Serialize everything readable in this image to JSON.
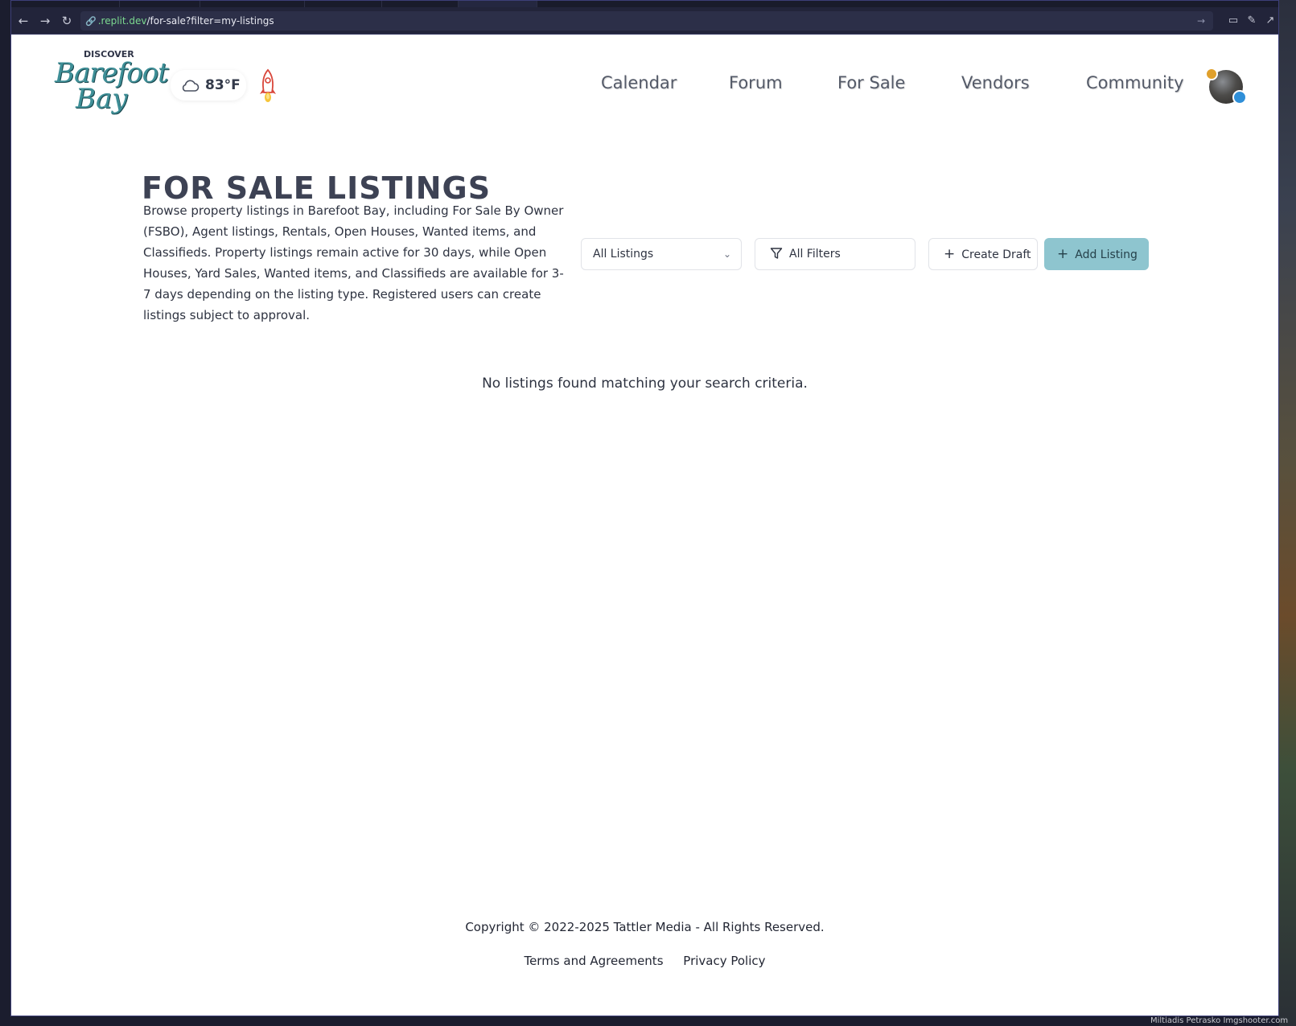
{
  "browser": {
    "url_domain": ".replit.dev",
    "url_path": "/for-sale?filter=my-listings",
    "back_icon": "arrow-left-icon",
    "forward_icon": "arrow-right-icon",
    "reload_icon": "reload-icon"
  },
  "header": {
    "logo": {
      "top_text": "DISCOVER",
      "line1": "Barefoot",
      "line2": "Bay"
    },
    "weather": {
      "temperature": "83°F",
      "icon": "cloud-icon"
    },
    "nav": [
      {
        "label": "Calendar"
      },
      {
        "label": "Forum"
      },
      {
        "label": "For Sale"
      },
      {
        "label": "Vendors"
      },
      {
        "label": "Community"
      }
    ]
  },
  "main": {
    "title": "FOR SALE LISTINGS",
    "description": "Browse property listings in Barefoot Bay, including For Sale By Owner (FSBO), Agent listings, Rentals, Open Houses, Wanted items, and Classifieds. Property listings remain active for 30 days, while Open Houses, Yard Sales, Wanted items, and Classifieds are available for 3-7 days depending on the listing type. Registered users can create listings subject to approval.",
    "listing_filter_value": "All Listings",
    "filters_label": "All Filters",
    "create_draft_label": "Create Draft",
    "add_listing_label": "Add Listing",
    "empty_message": "No listings found matching your search criteria."
  },
  "footer": {
    "copyright": "Copyright © 2022-2025 Tattler Media - All Rights Reserved.",
    "links": [
      "Terms and Agreements",
      "Privacy Policy"
    ]
  },
  "colors": {
    "accent_button": "#8ec5cf",
    "logo_teal": "#3e8f97",
    "text": "#2e3341"
  },
  "desktop": {
    "caption": "Miltiadis Petrasko Imgshooter.com"
  }
}
